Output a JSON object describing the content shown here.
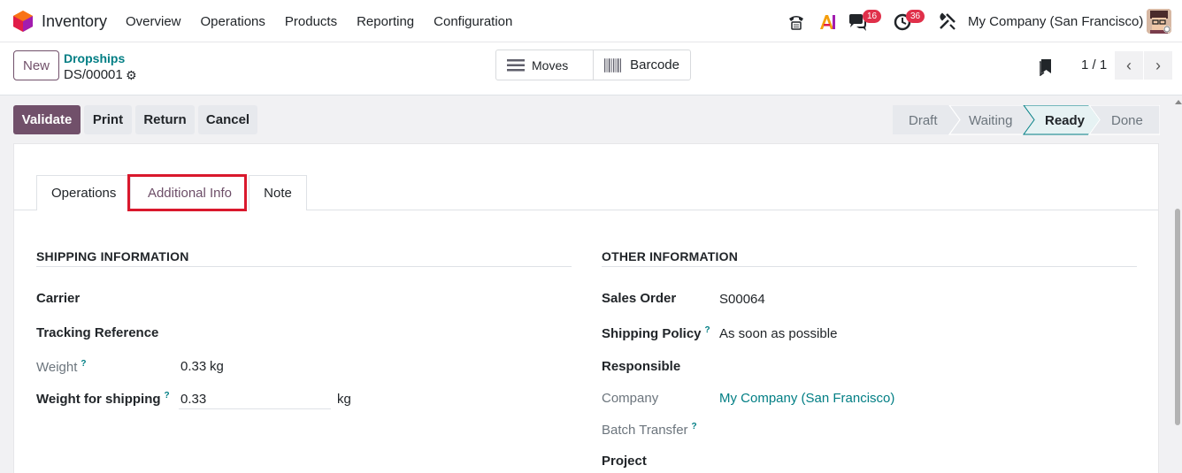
{
  "app": {
    "name": "Inventory"
  },
  "menu": [
    "Overview",
    "Operations",
    "Products",
    "Reporting",
    "Configuration"
  ],
  "systray": {
    "messages_count": "16",
    "activities_count": "36",
    "company": "My Company (San Francisco)"
  },
  "control": {
    "new_label": "New",
    "breadcrumb_parent": "Dropships",
    "record_name": "DS/00001",
    "smart_moves": "Moves",
    "smart_barcode": "Barcode",
    "pager": "1 / 1"
  },
  "actions": {
    "validate": "Validate",
    "print": "Print",
    "return": "Return",
    "cancel": "Cancel"
  },
  "status": [
    "Draft",
    "Waiting",
    "Ready",
    "Done"
  ],
  "status_active": "Ready",
  "tabs": [
    "Operations",
    "Additional Info",
    "Note"
  ],
  "tab_active": "Additional Info",
  "shipping": {
    "title": "SHIPPING INFORMATION",
    "carrier_label": "Carrier",
    "tracking_label": "Tracking Reference",
    "weight_label": "Weight",
    "weight_value": "0.33",
    "weight_unit": "kg",
    "shipping_weight_label": "Weight for shipping",
    "shipping_weight_value": "0.33",
    "shipping_weight_unit": "kg"
  },
  "other": {
    "title": "OTHER INFORMATION",
    "sales_order_label": "Sales Order",
    "sales_order_value": "S00064",
    "policy_label": "Shipping Policy",
    "policy_value": "As soon as possible",
    "responsible_label": "Responsible",
    "company_label": "Company",
    "company_value": "My Company (San Francisco)",
    "batch_label": "Batch Transfer",
    "project_label": "Project"
  },
  "help_mark": "?",
  "colors": {
    "primary": "#71506a",
    "link": "#017e84",
    "badge": "#e0304a",
    "highlight": "#d9182d"
  }
}
